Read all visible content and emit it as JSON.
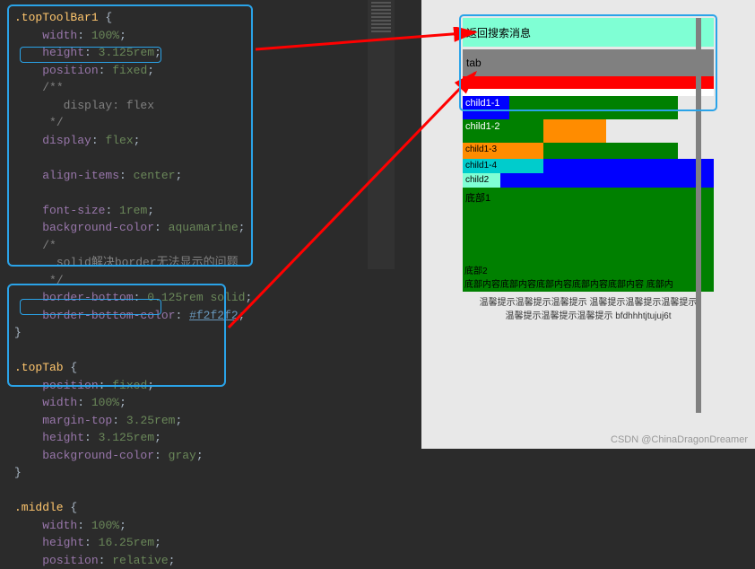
{
  "code": {
    "selector1": ".topToolBar1",
    "block1": [
      {
        "prop": "width",
        "val": "100%"
      },
      {
        "prop": "height",
        "val": "3.125rem"
      },
      {
        "prop": "position",
        "val": "fixed"
      }
    ],
    "comment1a": "/**",
    "comment1b": "   display: flex",
    "comment1c": " */",
    "block1b": [
      {
        "prop": "display",
        "val": "flex"
      },
      {
        "prop": "",
        "val": ""
      },
      {
        "prop": "align-items",
        "val": "center"
      },
      {
        "prop": "",
        "val": ""
      },
      {
        "prop": "font-size",
        "val": "1rem"
      },
      {
        "prop": "background-color",
        "val": "aquamarine"
      }
    ],
    "comment2a": "/*",
    "comment2b": "  solid解决border无法显示的问题",
    "comment2c": " */",
    "block1c": [
      {
        "prop": "border-bottom",
        "val": "0.125rem solid"
      },
      {
        "prop": "border-bottom-color",
        "hex": "#f2f2f2"
      }
    ],
    "selector2": ".topTab",
    "block2": [
      {
        "prop": "position",
        "val": "fixed"
      },
      {
        "prop": "width",
        "val": "100%"
      },
      {
        "prop": "margin-top",
        "val": "3.25rem"
      },
      {
        "prop": "height",
        "val": "3.125rem"
      },
      {
        "prop": "background-color",
        "val": "gray"
      }
    ],
    "selector3": ".middle",
    "block3": [
      {
        "prop": "width",
        "val": "100%"
      },
      {
        "prop": "height",
        "val": "16.25rem"
      },
      {
        "prop": "position",
        "val": "relative"
      }
    ]
  },
  "preview": {
    "top": "返回搜索消息",
    "tab": "tab",
    "c1": "child1-1",
    "c2": "child1-2",
    "c3": "child1-3",
    "c4": "child1-4",
    "c5": "child2",
    "bottom1": "底部1",
    "bottom2": "底部2",
    "bottom2text": "底部内容底部内容底部内容底部内容底部内容 底部内",
    "footer1": "温馨提示温馨提示温馨提示 温馨提示温馨提示温馨提示",
    "footer2": "温馨提示温馨提示温馨提示 bfdhhhtjtujuj6t"
  },
  "watermark": "CSDN @ChinaDragonDreamer"
}
